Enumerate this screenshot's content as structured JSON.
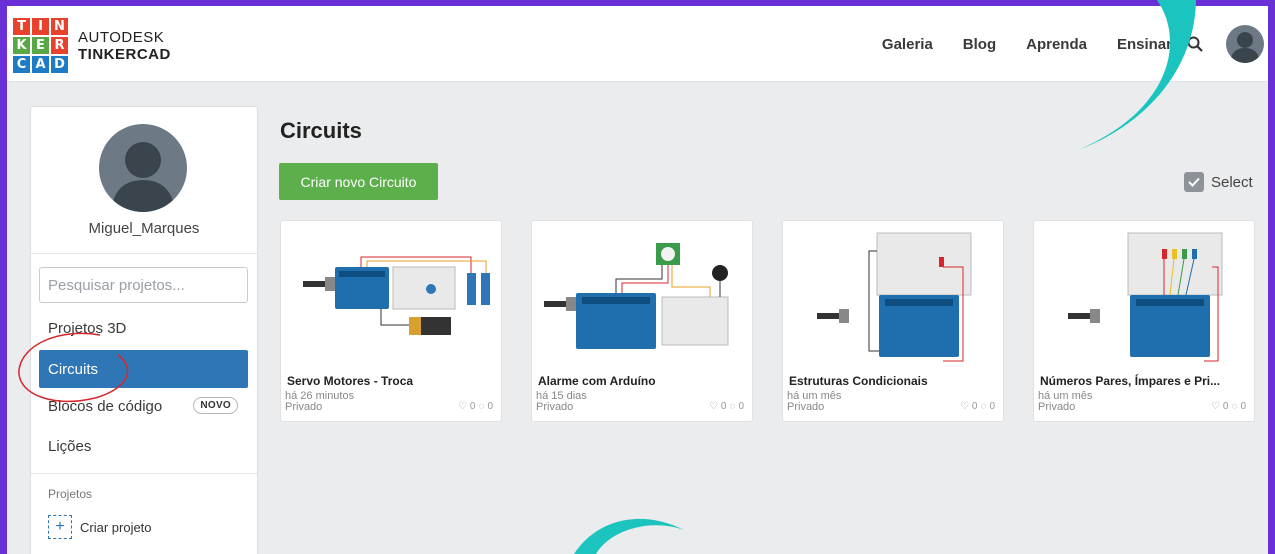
{
  "brand": {
    "logo_letters": [
      "T",
      "I",
      "N",
      "K",
      "E",
      "R",
      "C",
      "A",
      "D"
    ],
    "logo_colors": [
      "#e8412c",
      "#e8412c",
      "#e8412c",
      "#59a845",
      "#59a845",
      "#e8412c",
      "#1e7cc7",
      "#1e7cc7",
      "#1e7cc7"
    ],
    "line1": "AUTODESK",
    "line2": "TINKERCAD"
  },
  "topnav": {
    "items": [
      "Galeria",
      "Blog",
      "Aprenda",
      "Ensinar"
    ],
    "search_icon": "search-icon"
  },
  "sidebar": {
    "username": "Miguel_Marques",
    "search_placeholder": "Pesquisar projetos...",
    "nav": [
      {
        "label": "Projetos 3D"
      },
      {
        "label": "Circuits"
      },
      {
        "label": "Blocos de código",
        "badge": "NOVO"
      },
      {
        "label": "Lições"
      }
    ],
    "projects_label": "Projetos",
    "create_project": "Criar projeto"
  },
  "main": {
    "title": "Circuits",
    "create_button": "Criar novo Circuito",
    "select_label": "Select"
  },
  "cards": [
    {
      "name": "Servo Motores - Troca",
      "time": "há 26 minutos",
      "privacy": "Privado",
      "likes": "0",
      "comments": "0"
    },
    {
      "name": "Alarme com Arduíno",
      "time": "há 15 dias",
      "privacy": "Privado",
      "likes": "0",
      "comments": "0"
    },
    {
      "name": "Estruturas Condicionais",
      "time": "há um mês",
      "privacy": "Privado",
      "likes": "0",
      "comments": "0"
    },
    {
      "name": "Números Pares, Ímpares e Pri...",
      "time": "há um mês",
      "privacy": "Privado",
      "likes": "0",
      "comments": "0"
    }
  ],
  "colors": {
    "frame": "#6a30d8",
    "accent_blue": "#2f76b6",
    "button_green": "#5daf4b",
    "annotation_teal": "#1cc4bf",
    "annotation_red": "#d8262a"
  }
}
